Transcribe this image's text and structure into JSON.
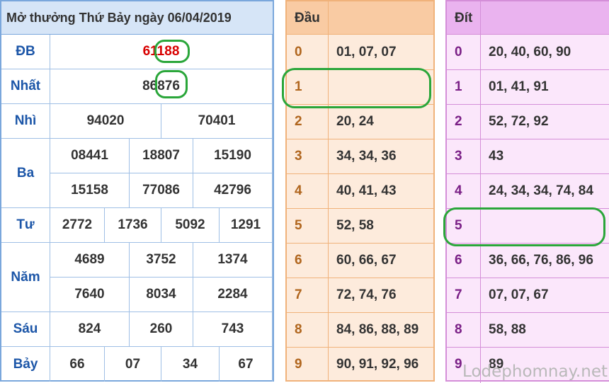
{
  "title": "Mở thưởng Thứ Bảy ngày 06/04/2019",
  "prizes": {
    "db": {
      "label": "ĐB",
      "values": [
        "61188"
      ]
    },
    "nhat": {
      "label": "Nhất",
      "values": [
        "86876"
      ]
    },
    "nhi": {
      "label": "Nhì",
      "values": [
        "94020",
        "70401"
      ]
    },
    "ba": {
      "label": "Ba",
      "values": [
        "08441",
        "18807",
        "15190",
        "15158",
        "77086",
        "42796"
      ]
    },
    "tu": {
      "label": "Tư",
      "values": [
        "2772",
        "1736",
        "5092",
        "1291"
      ]
    },
    "nam": {
      "label": "Năm",
      "values": [
        "4689",
        "3752",
        "1374",
        "7640",
        "8034",
        "2284"
      ]
    },
    "sau": {
      "label": "Sáu",
      "values": [
        "824",
        "260",
        "743"
      ]
    },
    "bay": {
      "label": "Bảy",
      "values": [
        "66",
        "07",
        "34",
        "67"
      ]
    }
  },
  "dau": {
    "header": "Đầu",
    "rows": [
      {
        "d": "0",
        "v": "01, 07, 07"
      },
      {
        "d": "1",
        "v": ""
      },
      {
        "d": "2",
        "v": "20, 24"
      },
      {
        "d": "3",
        "v": "34, 34, 36"
      },
      {
        "d": "4",
        "v": "40, 41, 43"
      },
      {
        "d": "5",
        "v": "52, 58"
      },
      {
        "d": "6",
        "v": "60, 66, 67"
      },
      {
        "d": "7",
        "v": "72, 74, 76"
      },
      {
        "d": "8",
        "v": "84, 86, 88, 89"
      },
      {
        "d": "9",
        "v": "90, 91, 92, 96"
      }
    ]
  },
  "dit": {
    "header": "Đít",
    "rows": [
      {
        "d": "0",
        "v": "20, 40, 60, 90"
      },
      {
        "d": "1",
        "v": "01, 41, 91"
      },
      {
        "d": "2",
        "v": "52, 72, 92"
      },
      {
        "d": "3",
        "v": "43"
      },
      {
        "d": "4",
        "v": "24, 34, 34, 74, 84"
      },
      {
        "d": "5",
        "v": ""
      },
      {
        "d": "6",
        "v": "36, 66, 76, 86, 96"
      },
      {
        "d": "7",
        "v": "07, 07, 67"
      },
      {
        "d": "8",
        "v": "58, 88"
      },
      {
        "d": "9",
        "v": "89"
      }
    ]
  },
  "watermark": "Lodephomnay.net",
  "colors": {
    "accent_red": "#d80000",
    "highlight_ring": "#2aa63a",
    "blue": "#1c56a8",
    "dau_index": "#b0651d",
    "dit_index": "#7a1f86"
  }
}
